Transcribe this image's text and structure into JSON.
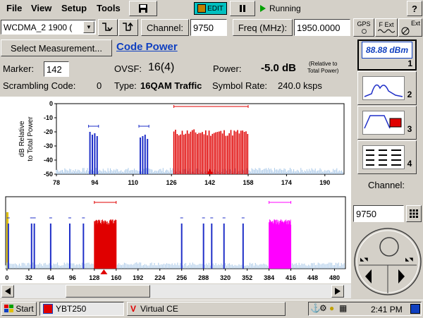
{
  "menu": {
    "file": "File",
    "view": "View",
    "setup": "Setup",
    "tools": "Tools",
    "help": "?"
  },
  "toolbar": {
    "edit_label": "EDIT",
    "status": "Running"
  },
  "controls": {
    "standard_select": "WCDMA_2 1900 (",
    "channel_label": "Channel:",
    "channel_value": "9750",
    "freq_label": "Freq (MHz):",
    "freq_value": "1950.0000",
    "gps_label": "GPS",
    "fext_label": "F Ext",
    "ext_label": "Ext"
  },
  "measurement": {
    "select_button": "Select Measurement...",
    "title": "Code Power"
  },
  "info": {
    "marker_label": "Marker:",
    "marker_value": "142",
    "ovsf_label": "OVSF:",
    "ovsf_value": "16(4)",
    "power_label": "Power:",
    "power_value": "-5.0 dB",
    "power_note_1": "(Relative to",
    "power_note_2": "Total Power)",
    "scrambling_label": "Scrambling Code:",
    "scrambling_value": "0",
    "type_label": "Type:",
    "type_value": "16QAM Traffic",
    "symbol_rate_label": "Symbol Rate:",
    "symbol_rate_value": "240.0 ksps"
  },
  "side_panel": {
    "readout": "88.88 dBm",
    "btn1": "1",
    "btn2": "2",
    "btn3": "3",
    "btn4": "4",
    "channel_label": "Channel:",
    "channel_value": "9750"
  },
  "taskbar": {
    "start": "Start",
    "task1": "YBT250",
    "task2": "Virtual CE",
    "time": "2:41 PM"
  },
  "colors": {
    "blue": "#1f2fc8",
    "red": "#e00000",
    "magenta": "#ff00ff",
    "noise": "#a8c8e8",
    "highlight": "#1040c0"
  },
  "chart_data": [
    {
      "type": "bar",
      "ylabel": "dB Relative to Total Power",
      "xlim": [
        78,
        198
      ],
      "ylim": [
        -50,
        0
      ],
      "x_ticks": [
        78,
        94,
        110,
        126,
        142,
        158,
        174,
        190
      ],
      "y_ticks": [
        0,
        -10,
        -20,
        -30,
        -40,
        -50
      ],
      "marker_x": 142,
      "noise_level": -47,
      "blue_groups": [
        {
          "x": [
            92,
            93,
            94,
            95
          ],
          "values": [
            -20,
            -22,
            -21,
            -23
          ]
        },
        {
          "x": [
            113,
            114,
            115,
            116
          ],
          "values": [
            -24,
            -23,
            -22,
            -25
          ]
        }
      ],
      "red_span": [
        127,
        158
      ],
      "red_level": -20
    },
    {
      "type": "bar",
      "xlim": [
        -2,
        496
      ],
      "x_ticks": [
        0,
        32,
        64,
        96,
        128,
        160,
        192,
        224,
        256,
        288,
        320,
        352,
        384,
        416,
        448,
        480
      ],
      "marker_x": 142,
      "blue_lines": [
        2,
        36,
        40,
        64,
        92,
        112,
        256,
        288,
        300,
        318,
        346
      ],
      "red_span": [
        128,
        160
      ],
      "magenta_span": [
        384,
        416
      ]
    }
  ]
}
